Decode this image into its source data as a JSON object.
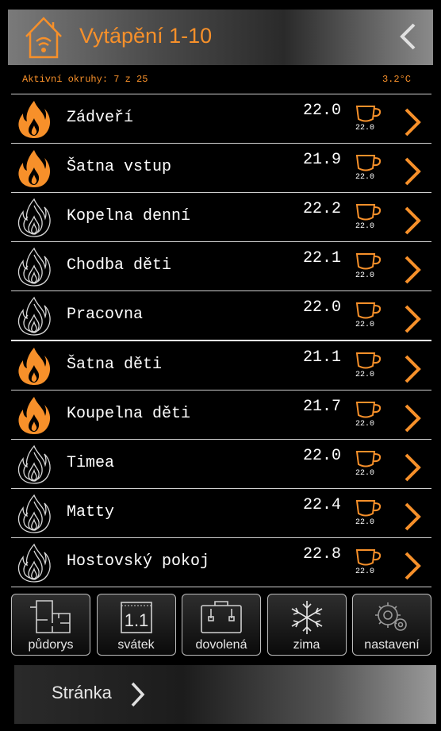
{
  "header": {
    "title": "Vytápění 1-10",
    "home_icon": "home-wifi-icon",
    "back_icon": "chevron-left-icon"
  },
  "status": {
    "active_circuits": "Aktivní okruhy: 7 z 25",
    "outdoor_temp": "3.2°C"
  },
  "colors": {
    "accent": "#f7902a",
    "text": "#ffffff"
  },
  "rooms": [
    {
      "name": "Zádveří",
      "temp": "22.0",
      "setpoint": "22.0",
      "heating": true
    },
    {
      "name": "Šatna vstup",
      "temp": "21.9",
      "setpoint": "22.0",
      "heating": true
    },
    {
      "name": "Kopelna denní",
      "temp": "22.2",
      "setpoint": "22.0",
      "heating": false
    },
    {
      "name": "Chodba děti",
      "temp": "22.1",
      "setpoint": "22.0",
      "heating": false
    },
    {
      "name": "Pracovna",
      "temp": "22.0",
      "setpoint": "22.0",
      "heating": false
    },
    {
      "name": "Šatna děti",
      "temp": "21.1",
      "setpoint": "22.0",
      "heating": true
    },
    {
      "name": "Koupelna děti",
      "temp": "21.7",
      "setpoint": "22.0",
      "heating": true
    },
    {
      "name": "Timea",
      "temp": "22.0",
      "setpoint": "22.0",
      "heating": false
    },
    {
      "name": "Matty",
      "temp": "22.4",
      "setpoint": "22.0",
      "heating": false
    },
    {
      "name": "Hostovský pokoj",
      "temp": "22.8",
      "setpoint": "22.0",
      "heating": false
    }
  ],
  "tiles": [
    {
      "label": "půdorys",
      "icon": "floorplan-icon"
    },
    {
      "label": "svátek",
      "icon": "calendar-icon",
      "icon_text": "1.1"
    },
    {
      "label": "dovolená",
      "icon": "suitcase-icon"
    },
    {
      "label": "zima",
      "icon": "snowflake-icon"
    },
    {
      "label": "nastavení",
      "icon": "gears-icon"
    }
  ],
  "footer": {
    "label": "Stránka"
  }
}
